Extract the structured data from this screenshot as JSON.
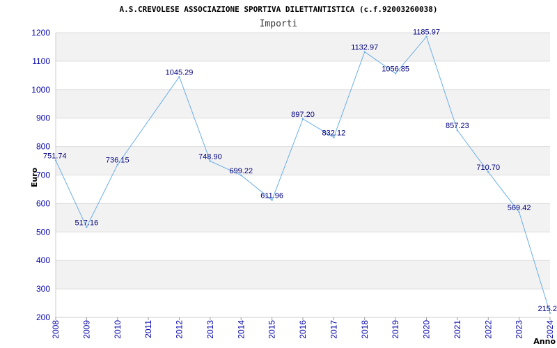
{
  "chart_data": {
    "type": "line",
    "title": "A.S.CREVOLESE ASSOCIAZIONE SPORTIVA DILETTANTISTICA (c.f.92003260038)",
    "subtitle": "Importi",
    "xlabel": "Anno",
    "ylabel": "Euro",
    "ylim": [
      200,
      1200
    ],
    "yticks": [
      "200",
      "300",
      "400",
      "500",
      "600",
      "700",
      "800",
      "900",
      "1000",
      "1100",
      "1200"
    ],
    "grid": true,
    "x": [
      "2008",
      "2009",
      "2010",
      "2011",
      "2012",
      "2013",
      "2014",
      "2015",
      "2016",
      "2017",
      "2018",
      "2019",
      "2020",
      "2021",
      "2022",
      "2023",
      "2024"
    ],
    "values": [
      751.74,
      517.16,
      736.15,
      null,
      1045.29,
      748.9,
      699.22,
      611.96,
      897.2,
      832.12,
      1132.97,
      1056.85,
      1185.97,
      857.23,
      710.7,
      569.42,
      215.2
    ],
    "labels": [
      "751.74",
      "517.16",
      "736.15",
      "",
      "1045.29",
      "748.90",
      "699.22",
      "611.96",
      "897.20",
      "832.12",
      "1132.97",
      "1056.85",
      "1185.97",
      "857.23",
      "710.70",
      "569.42",
      "215.2"
    ],
    "colors": {
      "line": "#6aaee8",
      "band": "#f2f2f2",
      "tick_text": "#0000aa",
      "label_text": "#000080"
    }
  }
}
